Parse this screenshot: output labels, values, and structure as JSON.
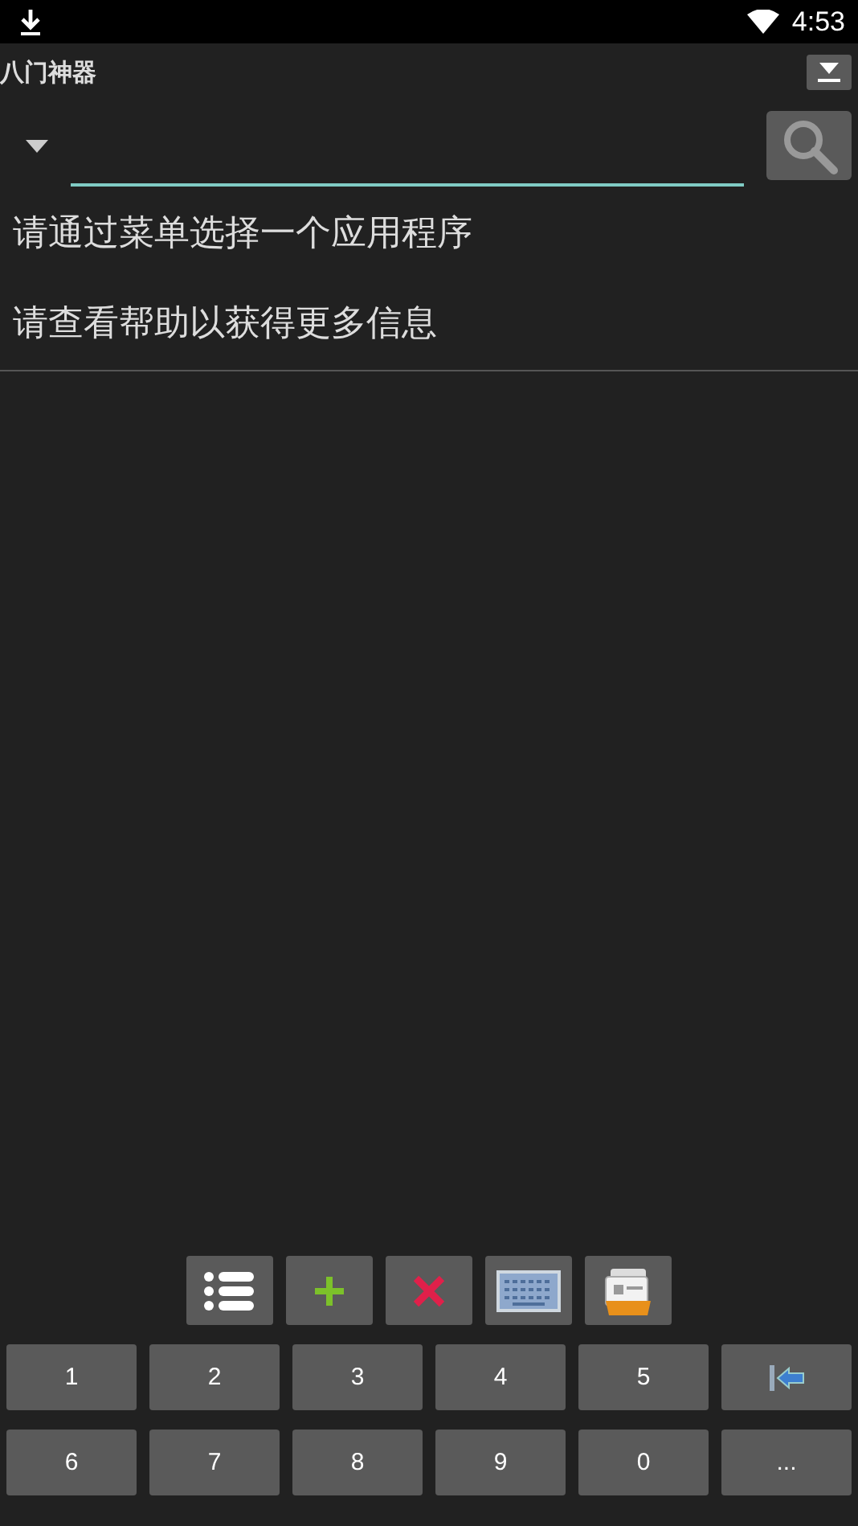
{
  "status_bar": {
    "time": "4:53"
  },
  "app_bar": {
    "title": "八门神器"
  },
  "messages": [
    "请通过菜单选择一个应用程序",
    "请查看帮助以获得更多信息"
  ],
  "toolbar": [
    {
      "kind": "list"
    },
    {
      "kind": "add"
    },
    {
      "kind": "delete"
    },
    {
      "kind": "keyboard"
    },
    {
      "kind": "folder"
    }
  ],
  "keypad": [
    {
      "kind": "text",
      "label": "1"
    },
    {
      "kind": "text",
      "label": "2"
    },
    {
      "kind": "text",
      "label": "3"
    },
    {
      "kind": "text",
      "label": "4"
    },
    {
      "kind": "text",
      "label": "5"
    },
    {
      "kind": "backspace"
    },
    {
      "kind": "text",
      "label": "6"
    },
    {
      "kind": "text",
      "label": "7"
    },
    {
      "kind": "text",
      "label": "8"
    },
    {
      "kind": "text",
      "label": "9"
    },
    {
      "kind": "text",
      "label": "0"
    },
    {
      "kind": "text",
      "label": "..."
    }
  ]
}
